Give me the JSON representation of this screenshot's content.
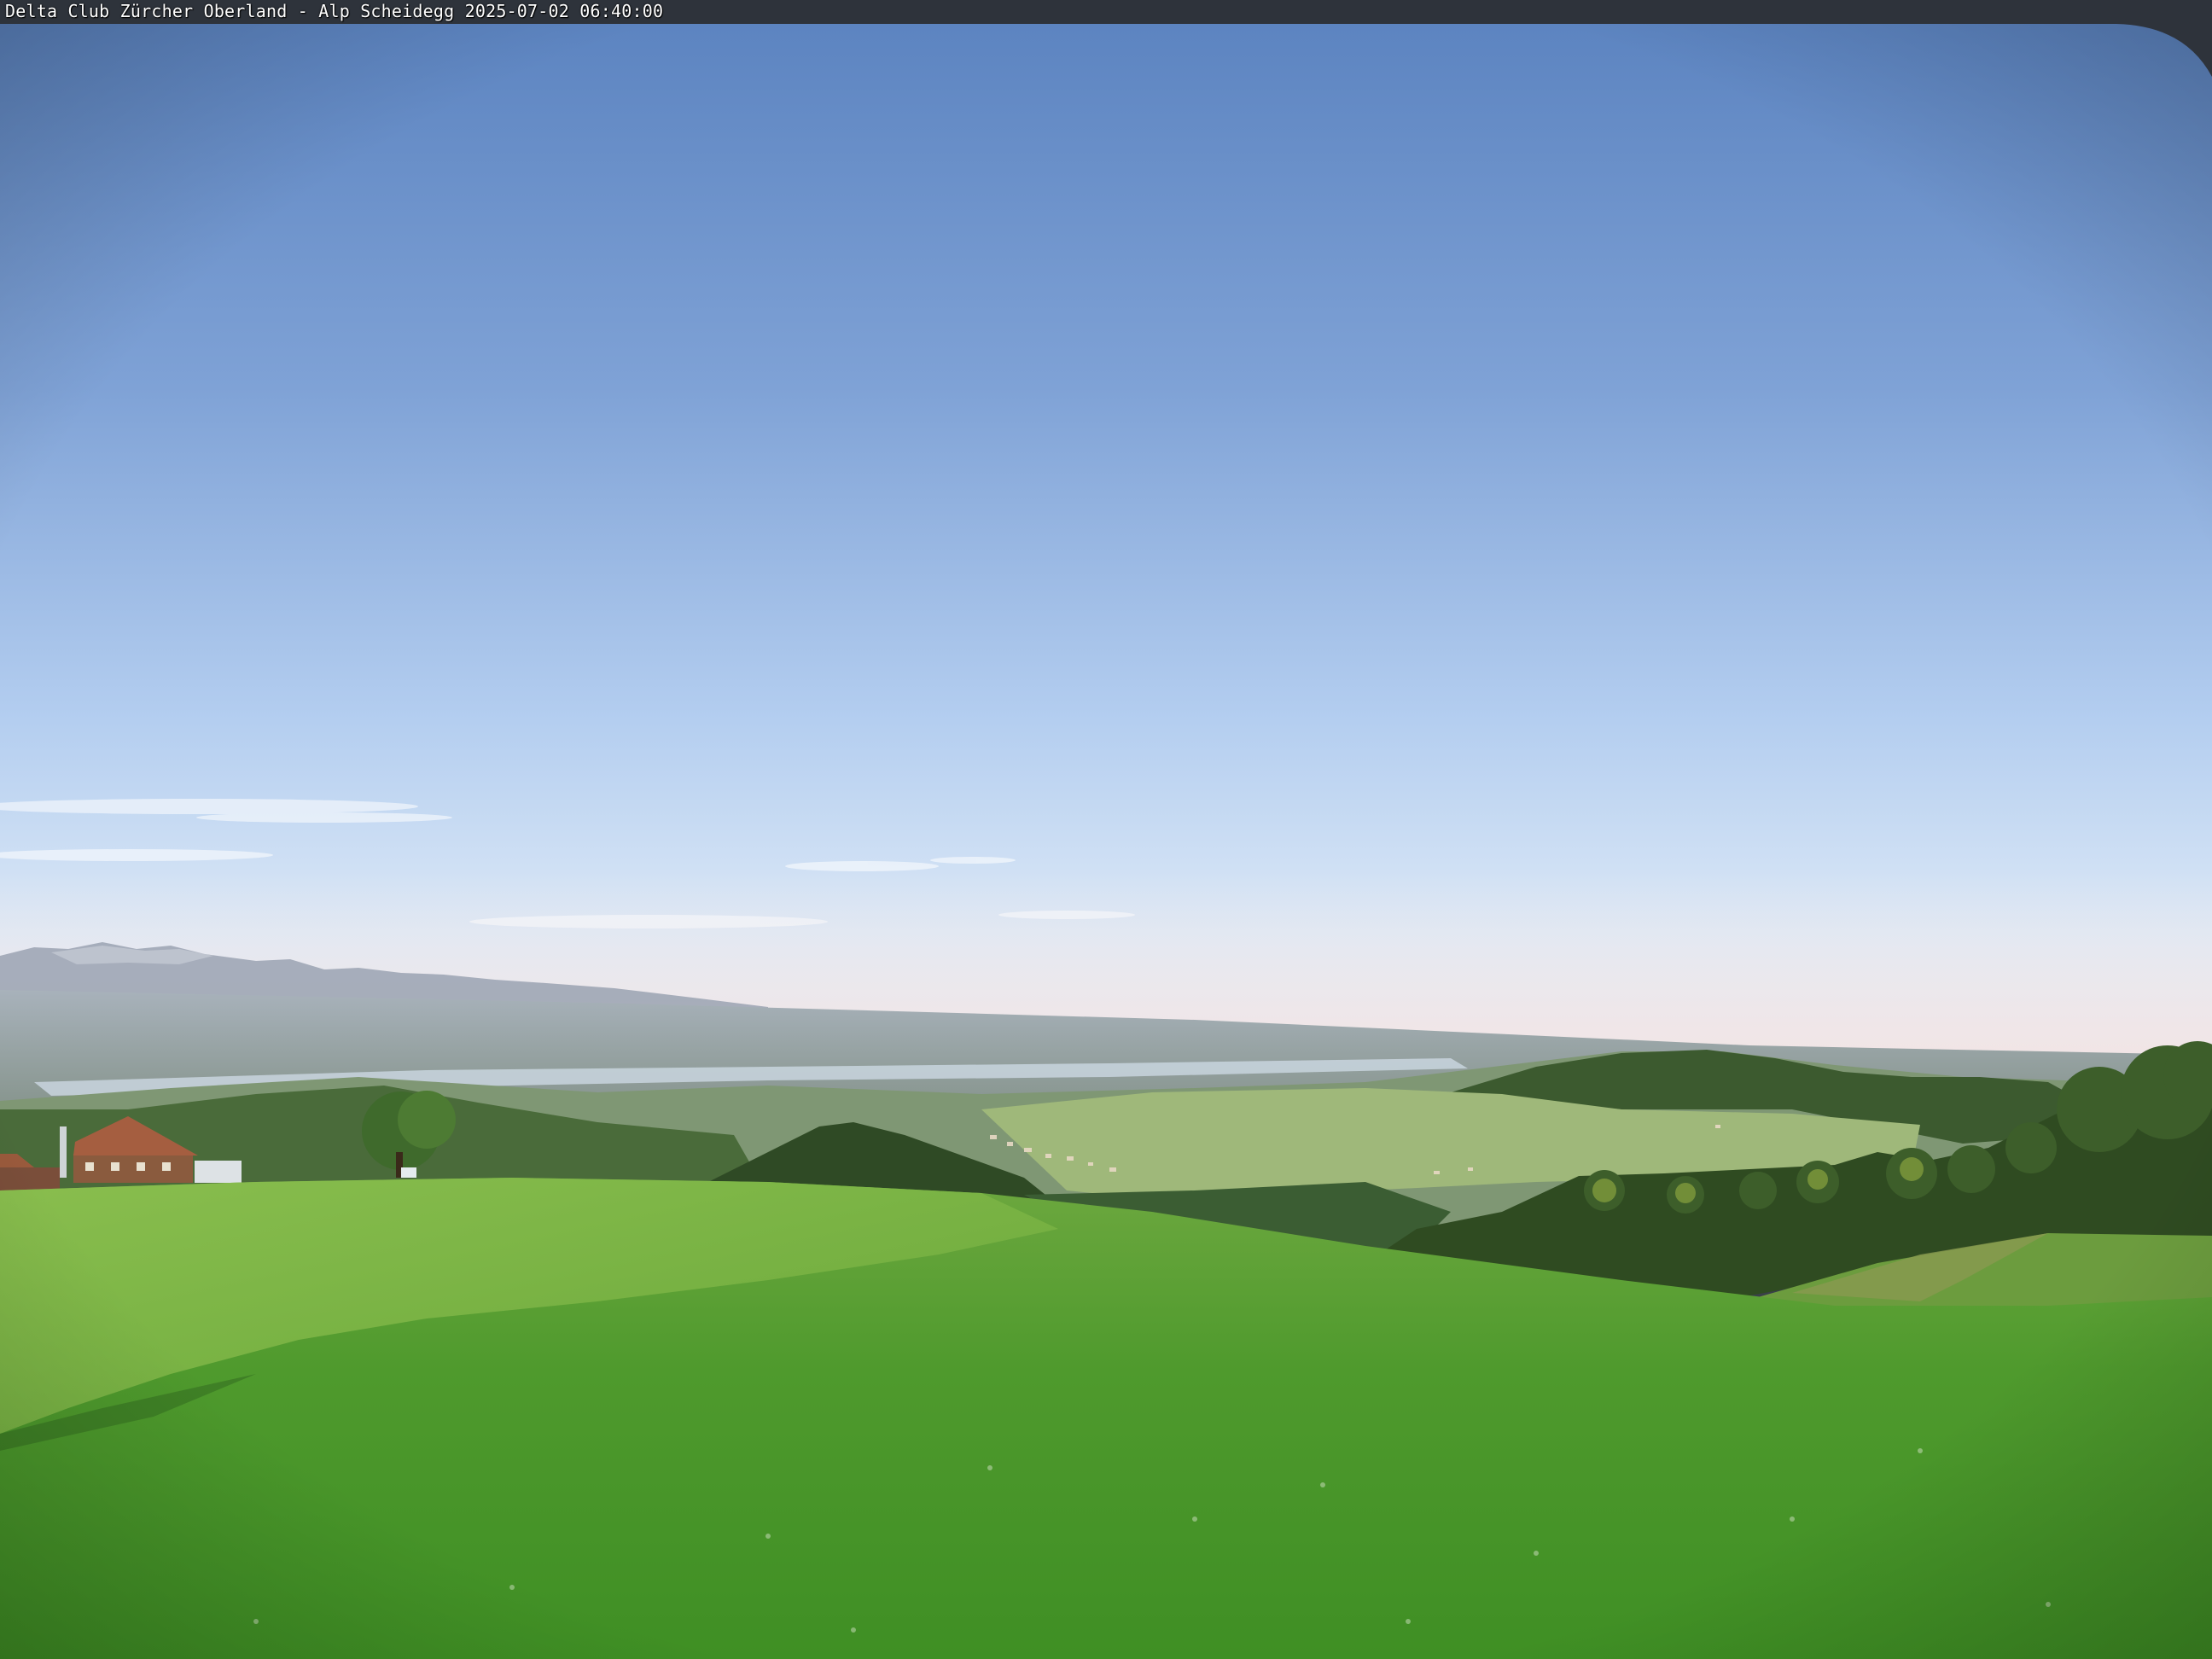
{
  "caption": "Delta Club Zürcher Oberland - Alp Scheidegg 2025-07-02 06:40:00",
  "scene": {
    "description_free": true,
    "colors": {
      "sky_top": "#5b83bf",
      "sky_mid": "#a4c2ea",
      "sky_horizon": "#e9eef2",
      "haze": "#f1e6e6",
      "mountains": "#9aa3b2",
      "lake": "#b9c6d0",
      "hills_far": "#6f8a6a",
      "forest": "#2f4a26",
      "meadow_light": "#76ad43",
      "meadow_mid": "#4f9a2e",
      "meadow_dark": "#3f8a24",
      "roof": "#9c5a3e",
      "frame_dark": "#2e333b"
    }
  }
}
